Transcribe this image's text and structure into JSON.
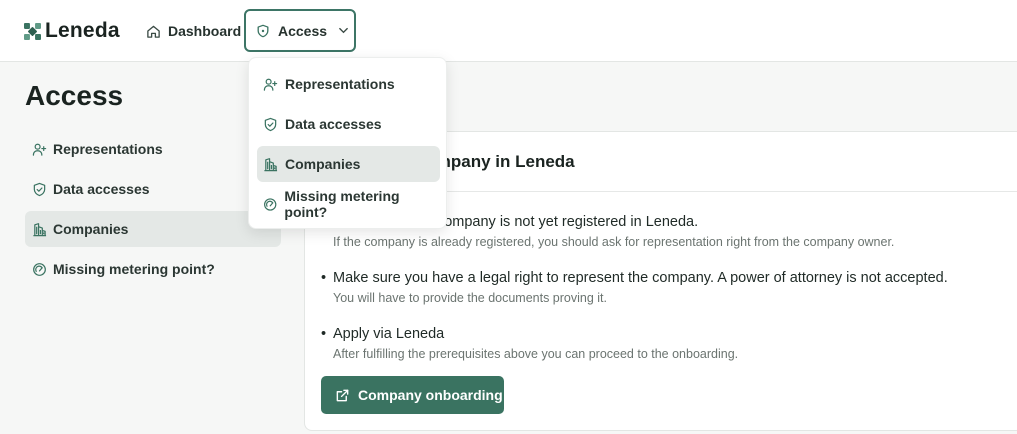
{
  "brand": {
    "name": "Leneda",
    "accent": "#3a7361",
    "logo_icon": "leneda-logo-icon"
  },
  "nav": {
    "dashboard_label": "Dashboard",
    "access_label": "Access"
  },
  "dropdown": {
    "items": [
      {
        "label": "Representations",
        "icon": "user-plus-icon"
      },
      {
        "label": "Data accesses",
        "icon": "shield-check-icon"
      },
      {
        "label": "Companies",
        "icon": "building-icon",
        "active": true
      },
      {
        "label": "Missing metering point?",
        "icon": "gauge-icon"
      }
    ]
  },
  "page": {
    "title": "Access"
  },
  "sidebar": {
    "items": [
      {
        "label": "Representations",
        "icon": "user-plus-icon"
      },
      {
        "label": "Data accesses",
        "icon": "shield-check-icon"
      },
      {
        "label": "Companies",
        "icon": "building-icon",
        "active": true
      },
      {
        "label": "Missing metering point?",
        "icon": "gauge-icon"
      }
    ]
  },
  "card": {
    "title": "Register a company in Leneda",
    "requirements": [
      {
        "text": "Make sure your company is not yet registered in Leneda.",
        "note": "If the company is already registered, you should ask for representation right from the company owner."
      },
      {
        "text": "Make sure you have a legal right to represent the company. A power of attorney is not accepted.",
        "note": "You will have to provide the documents proving it."
      },
      {
        "text": "Apply via Leneda",
        "note": "After fulfilling the prerequisites above you can proceed to the onboarding."
      }
    ],
    "button_label": "Company onboarding"
  }
}
